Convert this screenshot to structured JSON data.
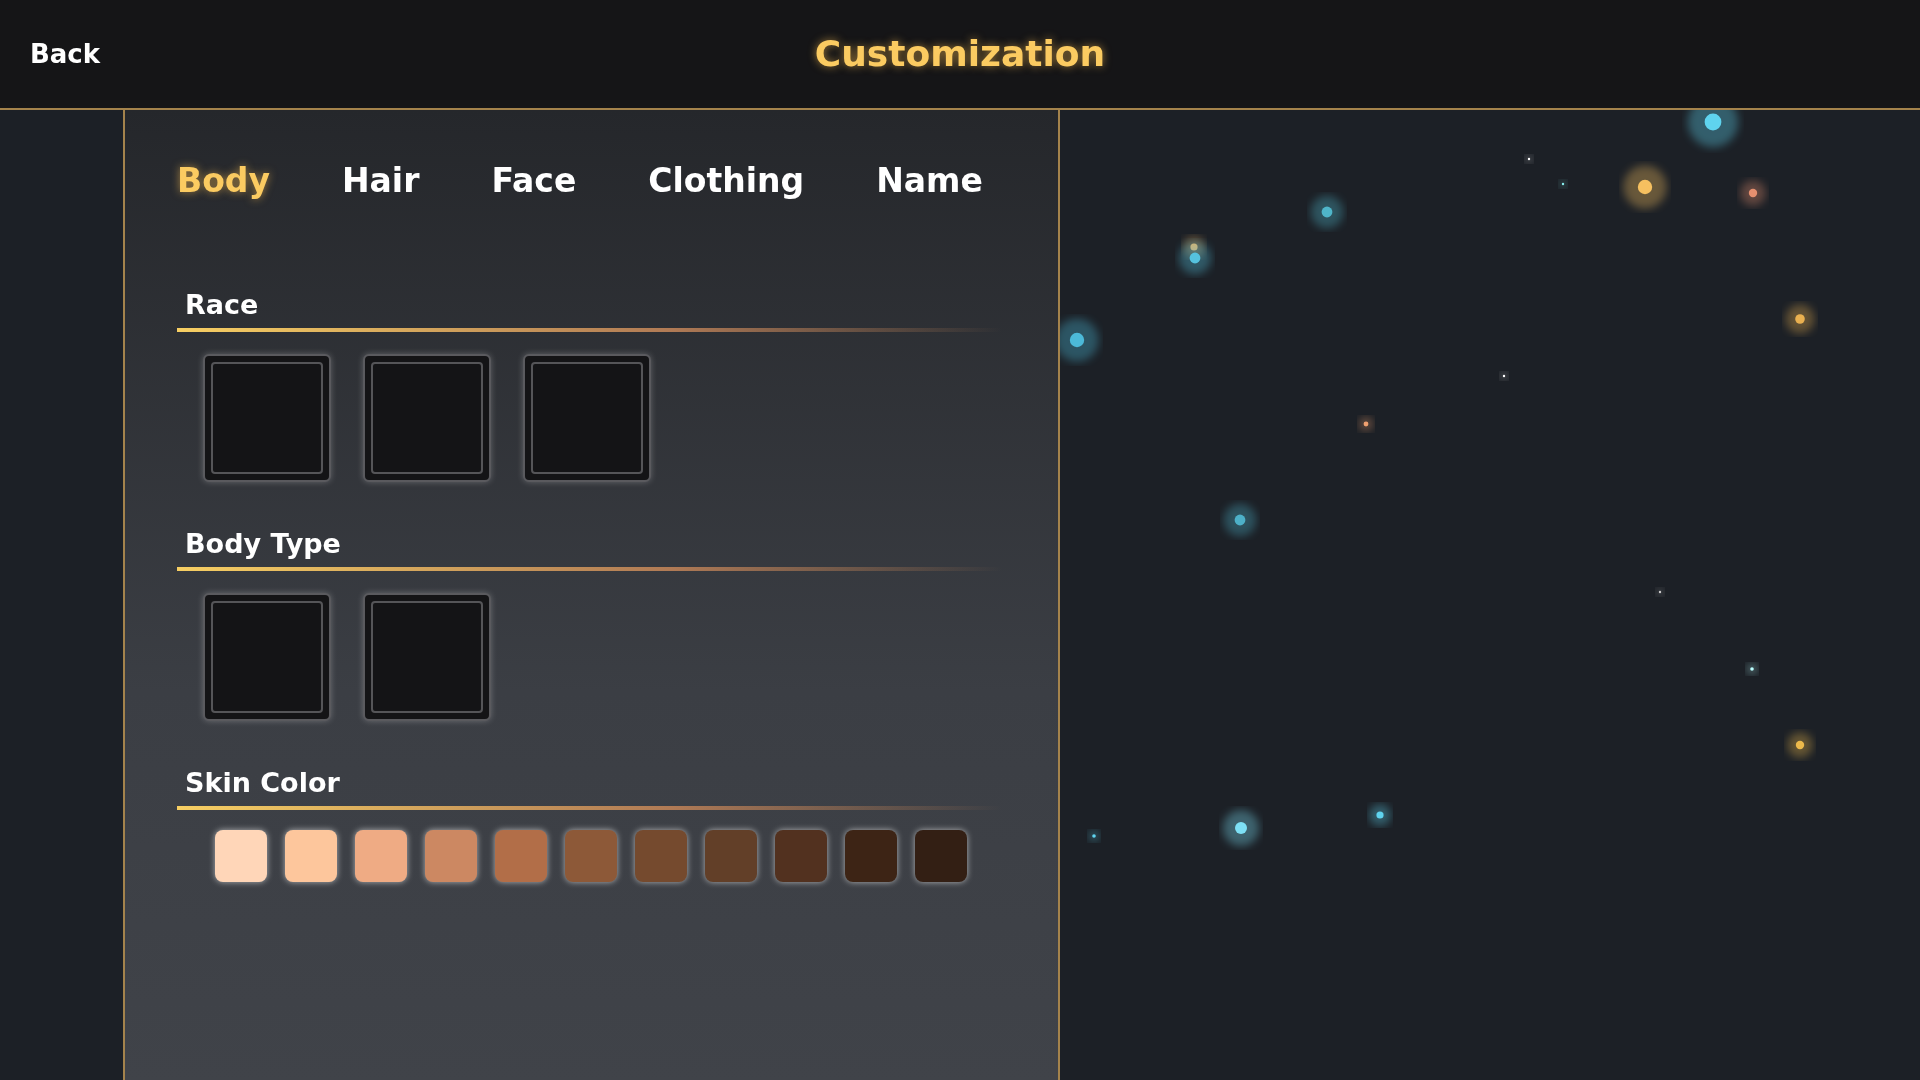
{
  "header": {
    "back": "Back",
    "title": "Customization"
  },
  "tabs": [
    {
      "label": "Body",
      "selected": true
    },
    {
      "label": "Hair",
      "selected": false
    },
    {
      "label": "Face",
      "selected": false
    },
    {
      "label": "Clothing",
      "selected": false
    },
    {
      "label": "Name",
      "selected": false
    }
  ],
  "sections": [
    {
      "kind": "tiles",
      "label": "Race",
      "options": [
        {
          "selected": false
        },
        {
          "selected": false
        },
        {
          "selected": false
        }
      ]
    },
    {
      "kind": "tiles",
      "label": "Body Type",
      "options": [
        {
          "selected": false
        },
        {
          "selected": false
        }
      ]
    },
    {
      "kind": "swatches",
      "label": "Skin Color",
      "options": [
        {
          "color": "#ffd6b8",
          "selected": false
        },
        {
          "color": "#fdc69c",
          "selected": false
        },
        {
          "color": "#efab84",
          "selected": false
        },
        {
          "color": "#cc8862",
          "selected": false
        },
        {
          "color": "#b26e48",
          "selected": false
        },
        {
          "color": "#8d5938",
          "selected": false
        },
        {
          "color": "#754a2e",
          "selected": false
        },
        {
          "color": "#623f28",
          "selected": false
        },
        {
          "color": "#52311f",
          "selected": false
        },
        {
          "color": "#3d2415",
          "selected": false
        },
        {
          "color": "#331f14",
          "selected": false
        }
      ]
    }
  ]
}
